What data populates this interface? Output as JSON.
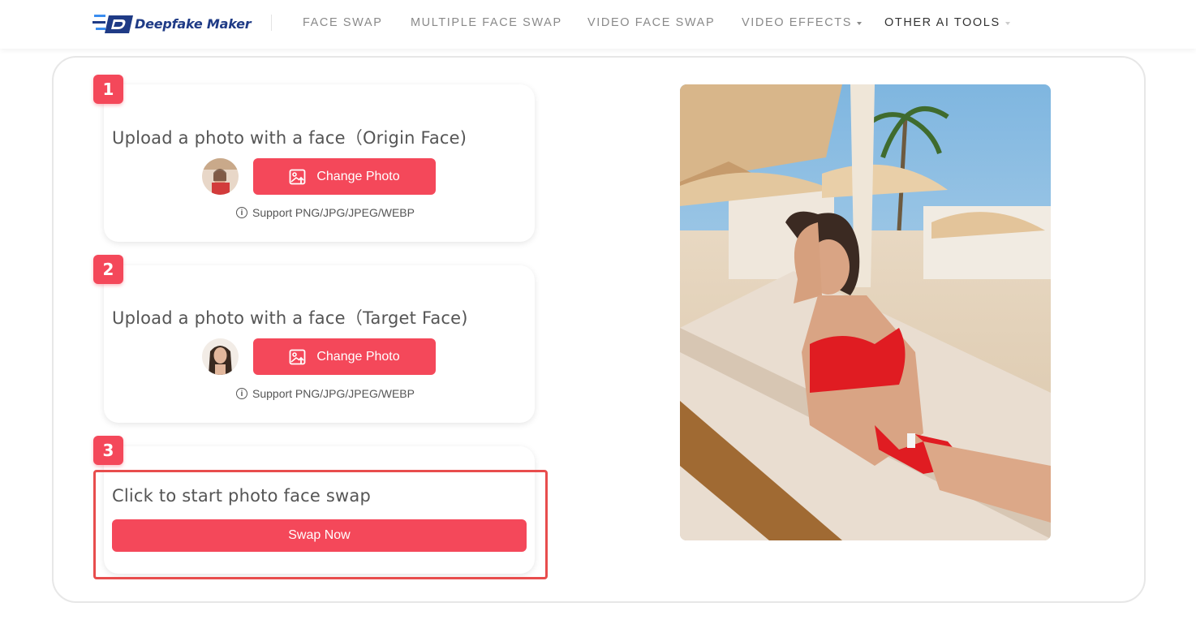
{
  "header": {
    "logo_text": "Deepfake Maker",
    "nav": [
      {
        "label": "FACE SWAP",
        "dropdown": false
      },
      {
        "label": "MULTIPLE FACE SWAP",
        "dropdown": false
      },
      {
        "label": "VIDEO FACE SWAP",
        "dropdown": false
      },
      {
        "label": "VIDEO EFFECTS",
        "dropdown": true
      },
      {
        "label": "OTHER AI TOOLS",
        "dropdown": true
      }
    ]
  },
  "steps": [
    {
      "number": "1",
      "title": "Upload a photo with a face（Origin Face)",
      "button": "Change Photo",
      "support": "Support PNG/JPG/JPEG/WEBP"
    },
    {
      "number": "2",
      "title": "Upload a photo with a face（Target Face)",
      "button": "Change Photo",
      "support": "Support PNG/JPG/JPEG/WEBP"
    },
    {
      "number": "3",
      "title": "Click to start photo face swap",
      "button": "Swap Now"
    }
  ],
  "colors": {
    "accent": "#f4485a",
    "highlight": "#e84d4d",
    "logo": "#1f3b86"
  },
  "icons": {
    "upload": "image-upload-icon",
    "info": "info-icon",
    "dropdown": "caret-down-icon"
  }
}
